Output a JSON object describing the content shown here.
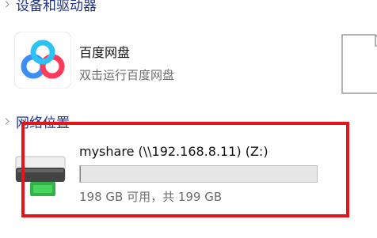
{
  "sections": {
    "devices": {
      "title": "设备和驱动器"
    },
    "network": {
      "title": "网络位置"
    }
  },
  "app": {
    "name": "百度网盘",
    "subtitle": "双击运行百度网盘",
    "icon": "baidu-netdisk-icon"
  },
  "drive": {
    "name": "myshare (\\\\192.168.8.11) (Z:)",
    "free_text": "198 GB 可用，共 199 GB",
    "used_fraction": 0.005,
    "icon": "network-drive-icon"
  },
  "colors": {
    "section_header": "#1e3287",
    "secondary_text": "#6c6c6c",
    "highlight": "#e5141b",
    "bar_fill": "#26a0da",
    "bar_bg": "#e6e6e6"
  }
}
